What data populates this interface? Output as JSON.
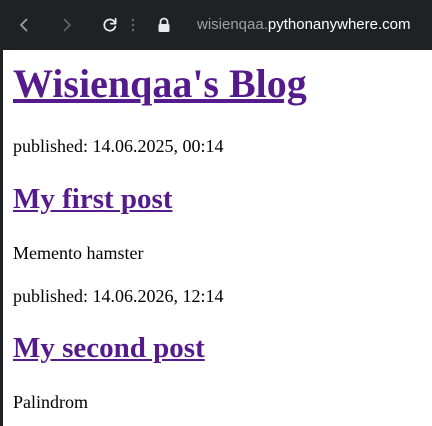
{
  "browser": {
    "url_subdomain": "wisienqaa.",
    "url_domain": "pythonanywhere.com",
    "toolbar_color": "#202124",
    "icons": [
      "back-arrow-icon",
      "forward-arrow-icon",
      "reload-icon",
      "lock-icon"
    ]
  },
  "page": {
    "blog_title": "Wisienqaa's Blog",
    "link_color": "#551a8b",
    "posts": [
      {
        "published": "published: 14.06.2025, 00:14",
        "title": "My first post",
        "text": "Memento hamster"
      },
      {
        "published": "published: 14.06.2026, 12:14",
        "title": "My second post",
        "text": "Palindrom"
      }
    ]
  }
}
